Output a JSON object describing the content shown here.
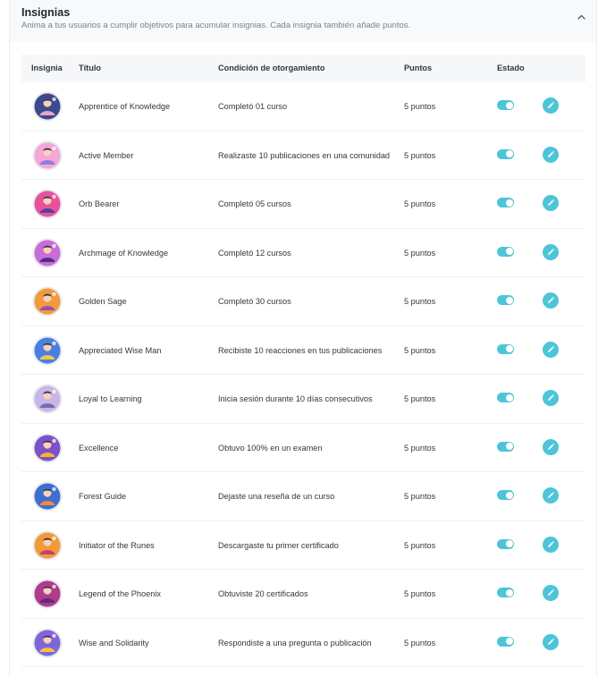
{
  "section": {
    "title": "Insignias",
    "subtitle": "Anima a tus usuarios a cumplir objetivos para acumular insignias. Cada insignia también añade puntos."
  },
  "columns": {
    "badge": "Insignia",
    "title": "Título",
    "condition": "Condición de otorgamiento",
    "points": "Puntos",
    "status": "Estado"
  },
  "colors": {
    "accent": "#4ec4d9"
  },
  "rows": [
    {
      "title": "Apprentice of Knowledge",
      "condition": "Completó 01 curso",
      "points": "5 puntos",
      "enabled": true,
      "bg": "#3a4a8c",
      "accent": "#e9a6c7",
      "icon": "graduation-badge-icon"
    },
    {
      "title": "Active Member",
      "condition": "Realizaste 10 publicaciones en una comunidad",
      "points": "5 puntos",
      "enabled": true,
      "bg": "#f4a6d6",
      "accent": "#8e7be0",
      "icon": "community-badge-icon"
    },
    {
      "title": "Orb Bearer",
      "condition": "Completó 05 cursos",
      "points": "5 puntos",
      "enabled": true,
      "bg": "#e9529b",
      "accent": "#5a3d9e",
      "icon": "orb-badge-icon"
    },
    {
      "title": "Archmage of Knowledge",
      "condition": "Completó 12 cursos",
      "points": "5 puntos",
      "enabled": true,
      "bg": "#c86cd8",
      "accent": "#4b2f8a",
      "icon": "archmage-badge-icon"
    },
    {
      "title": "Golden Sage",
      "condition": "Completó 30 cursos",
      "points": "5 puntos",
      "enabled": true,
      "bg": "#f39a3c",
      "accent": "#9a4fb0",
      "icon": "sage-badge-icon"
    },
    {
      "title": "Appreciated Wise Man",
      "condition": "Recibiste 10 reacciones en tus publicaciones",
      "points": "5 puntos",
      "enabled": true,
      "bg": "#4a7fe0",
      "accent": "#f2c94c",
      "icon": "reactions-badge-icon"
    },
    {
      "title": "Loyal to Learning",
      "condition": "Inicia sesión durante 10 días consecutivos",
      "points": "5 puntos",
      "enabled": true,
      "bg": "#c9b6e6",
      "accent": "#6b6fb8",
      "icon": "calendar-badge-icon"
    },
    {
      "title": "Excellence",
      "condition": "Obtuvo 100% en un examen",
      "points": "5 puntos",
      "enabled": true,
      "bg": "#7b52c9",
      "accent": "#f2b632",
      "icon": "trophy-badge-icon"
    },
    {
      "title": "Forest Guide",
      "condition": "Dejaste una reseña de un curso",
      "points": "5 puntos",
      "enabled": true,
      "bg": "#3b6fd1",
      "accent": "#f08a3c",
      "icon": "fox-badge-icon"
    },
    {
      "title": "Initiator of the Runes",
      "condition": "Descargaste tu primer certificado",
      "points": "5 puntos",
      "enabled": true,
      "bg": "#f29a3a",
      "accent": "#c83e6a",
      "icon": "certificate-badge-icon"
    },
    {
      "title": "Legend of the Phoenix",
      "condition": "Obtuviste 20 certificados",
      "points": "5 puntos",
      "enabled": true,
      "bg": "#b03a8c",
      "accent": "#5a2c7a",
      "icon": "phoenix-badge-icon"
    },
    {
      "title": "Wise and Solidarity",
      "condition": "Respondiste a una pregunta o publicación",
      "points": "5 puntos",
      "enabled": true,
      "bg": "#7d66d8",
      "accent": "#f2c14e",
      "icon": "solidarity-badge-icon"
    }
  ]
}
